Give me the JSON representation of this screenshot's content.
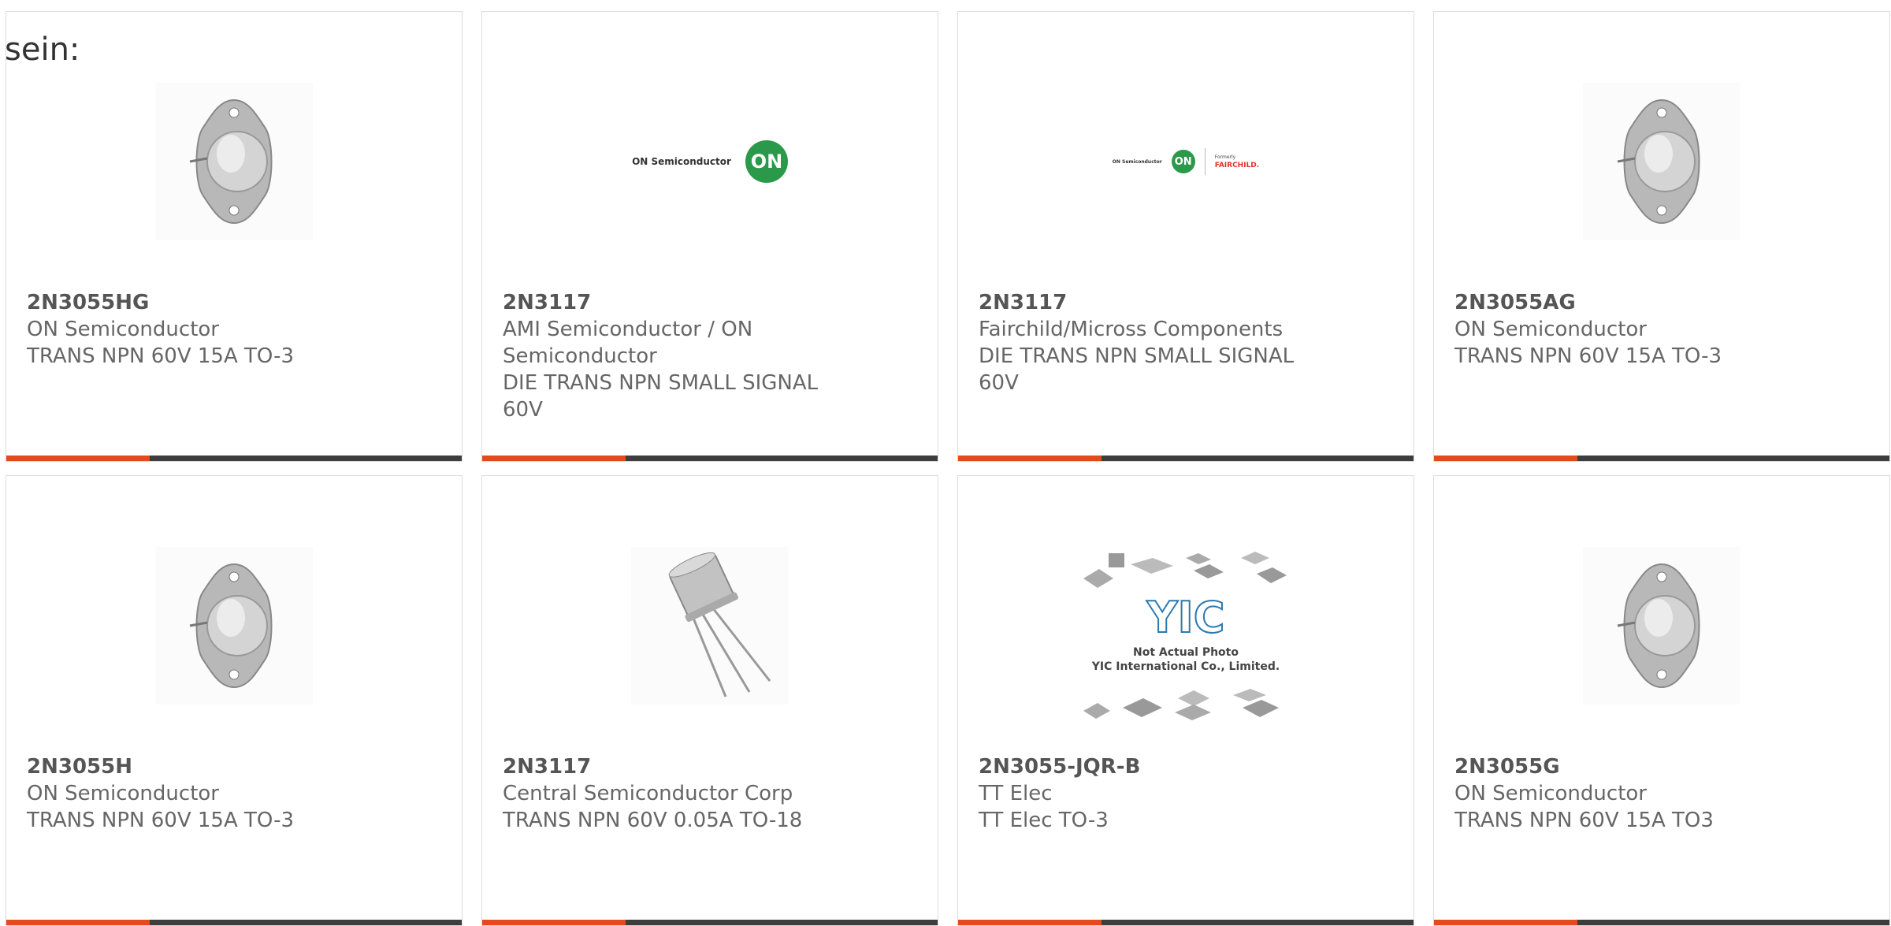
{
  "intro": "sein:",
  "colors": {
    "accent": "#e24b1b",
    "bar": "#3d3d3d",
    "border": "#dcdcdc",
    "text": "#666666"
  },
  "products": [
    {
      "part": "2N3055HG",
      "mfr": "ON Semiconductor",
      "desc": "TRANS NPN 60V 15A TO-3",
      "image": "to3-transistor-icon"
    },
    {
      "part": "2N3117",
      "mfr": "AMI Semiconductor / ON Semiconductor",
      "desc": "DIE TRANS NPN SMALL SIGNAL 60V",
      "image": "on-semiconductor-logo",
      "logo_text": "ON Semiconductor",
      "logo_badge": "ON"
    },
    {
      "part": "2N3117",
      "mfr": "Fairchild/Micross Components",
      "desc": "DIE TRANS NPN SMALL SIGNAL 60V",
      "image": "on-fairchild-logo",
      "logo_text": "ON Semiconductor",
      "logo_badge": "ON",
      "logo_formerly": "Formerly",
      "logo_fairchild": "FAIRCHILD."
    },
    {
      "part": "2N3055AG",
      "mfr": "ON Semiconductor",
      "desc": "TRANS NPN 60V 15A TO-3",
      "image": "to3-transistor-icon"
    },
    {
      "part": "2N3055H",
      "mfr": "ON Semiconductor",
      "desc": "TRANS NPN 60V 15A TO-3",
      "image": "to3-transistor-icon"
    },
    {
      "part": "2N3117",
      "mfr": "Central Semiconductor Corp",
      "desc": "TRANS NPN 60V 0.05A TO-18",
      "image": "to18-transistor-icon"
    },
    {
      "part": "2N3055-JQR-B",
      "mfr": "TT Elec",
      "desc": "TT Elec TO-3",
      "image": "yic-placeholder-image",
      "placeholder_line1": "Not Actual Photo",
      "placeholder_line2": "YIC International Co., Limited.",
      "placeholder_logo": "YIC"
    },
    {
      "part": "2N3055G",
      "mfr": "ON Semiconductor",
      "desc": "TRANS NPN 60V 15A TO3",
      "image": "to3-transistor-icon"
    }
  ]
}
